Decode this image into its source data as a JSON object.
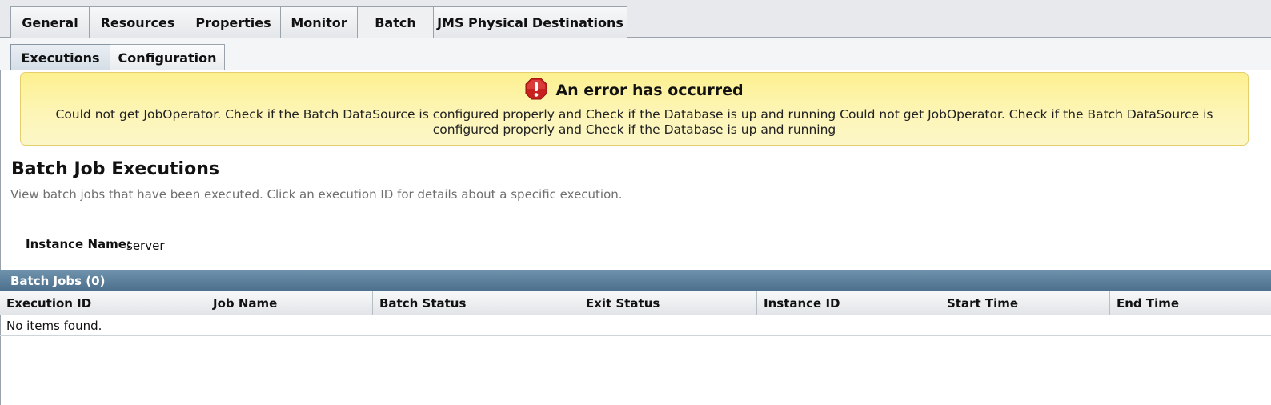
{
  "tabs": [
    {
      "label": "General"
    },
    {
      "label": "Resources"
    },
    {
      "label": "Properties"
    },
    {
      "label": "Monitor"
    },
    {
      "label": "Batch",
      "active": true
    },
    {
      "label": "JMS Physical Destinations"
    }
  ],
  "subtabs": [
    {
      "label": "Executions",
      "active": true
    },
    {
      "label": "Configuration"
    }
  ],
  "alert": {
    "icon": "error-icon",
    "title": "An error has occurred",
    "message": "Could not get JobOperator. Check if the Batch DataSource is configured properly and Check if the Database is up and running Could not get JobOperator. Check if the Batch DataSource is configured properly and Check if the Database is up and running"
  },
  "page": {
    "title": "Batch Job Executions",
    "help": "View batch jobs that have been executed. Click an execution ID for details about a specific execution."
  },
  "instance": {
    "label": "Instance Name:",
    "value": "server"
  },
  "table": {
    "caption": "Batch Jobs (0)",
    "columns": [
      "Execution ID",
      "Job Name",
      "Batch Status",
      "Exit Status",
      "Instance ID",
      "Start Time",
      "End Time"
    ],
    "empty_text": "No items found."
  },
  "colors": {
    "alert_bg": "#fdf5b6",
    "table_caption_bg": "#5a7e9b"
  }
}
